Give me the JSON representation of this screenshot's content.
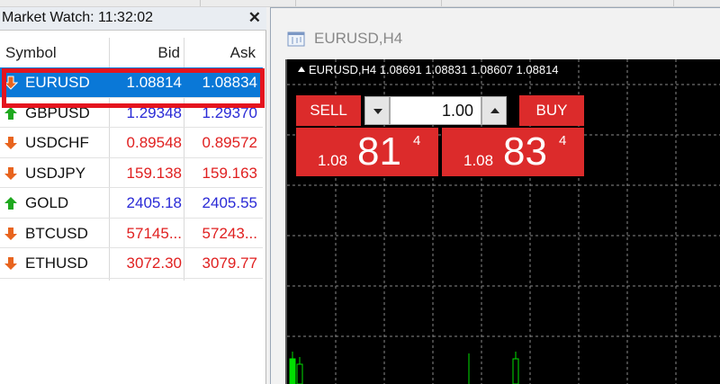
{
  "market_watch": {
    "title": "Market Watch: 11:32:02",
    "columns": {
      "symbol": "Symbol",
      "bid": "Bid",
      "ask": "Ask"
    },
    "rows": [
      {
        "symbol": "EURUSD",
        "bid": "1.08814",
        "ask": "1.08834",
        "direction": "down",
        "selected": true
      },
      {
        "symbol": "GBPUSD",
        "bid": "1.29348",
        "ask": "1.29370",
        "direction": "up",
        "price_color": "blue"
      },
      {
        "symbol": "USDCHF",
        "bid": "0.89548",
        "ask": "0.89572",
        "direction": "down",
        "price_color": "red"
      },
      {
        "symbol": "USDJPY",
        "bid": "159.138",
        "ask": "159.163",
        "direction": "down",
        "price_color": "red"
      },
      {
        "symbol": "GOLD",
        "bid": "2405.18",
        "ask": "2405.55",
        "direction": "up",
        "price_color": "blue"
      },
      {
        "symbol": "BTCUSD",
        "bid": "57145...",
        "ask": "57243...",
        "direction": "down",
        "price_color": "red"
      },
      {
        "symbol": "ETHUSD",
        "bid": "3072.30",
        "ask": "3079.77",
        "direction": "down",
        "price_color": "red"
      }
    ]
  },
  "chart_window": {
    "title": "EURUSD,H4",
    "info_line": "EURUSD,H4  1.08691 1.08831 1.08607 1.08814",
    "trade_panel": {
      "sell_label": "SELL",
      "buy_label": "BUY",
      "lot_value": "1.00",
      "sell_quote": {
        "small": "1.08",
        "big": "81",
        "sup": "4"
      },
      "buy_quote": {
        "small": "1.08",
        "big": "83",
        "sup": "4"
      }
    }
  },
  "colors": {
    "selection": "#0a78d7",
    "highlight_box": "#e4141e",
    "trade_red": "#dc2b2b",
    "price_blue": "#2a2ad6",
    "price_red": "#e02020",
    "arrow_up": "#1ea81e",
    "arrow_down": "#e8641e"
  }
}
